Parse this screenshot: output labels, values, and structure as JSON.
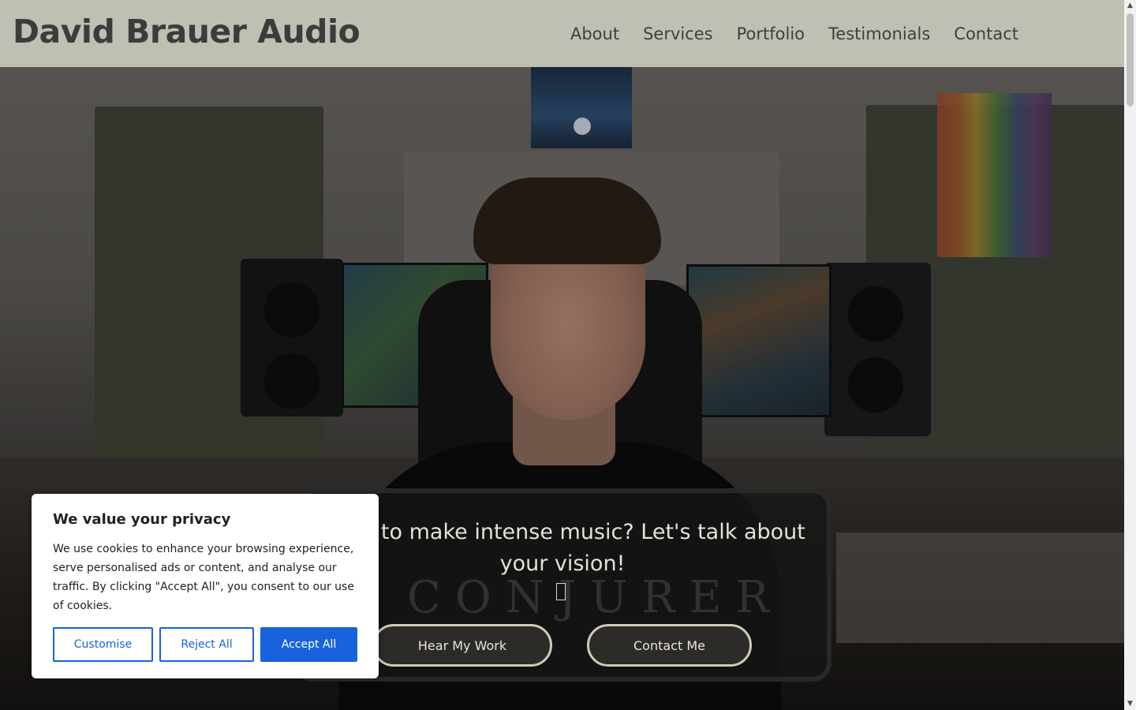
{
  "header": {
    "brand": "David Brauer Audio",
    "nav": [
      {
        "label": "About"
      },
      {
        "label": "Services"
      },
      {
        "label": "Portfolio"
      },
      {
        "label": "Testimonials"
      },
      {
        "label": "Contact"
      }
    ]
  },
  "hero": {
    "watermark": "CONJURER",
    "cta_heading": "Want to make intense music? Let's talk about your vision!",
    "cta_icon": "music-note-icon",
    "buttons": {
      "hear_work": "Hear My Work",
      "contact": "Contact Me"
    }
  },
  "cookie_banner": {
    "title": "We value your privacy",
    "text": "We use cookies to enhance your browsing experience, serve personalised ads or content, and analyse our traffic. By clicking \"Accept All\", you consent to our use of cookies.",
    "customise": "Customise",
    "reject": "Reject All",
    "accept": "Accept All",
    "accent_color": "#1863dc"
  },
  "colors": {
    "header_bg": "#c7c8ba",
    "button_border": "#cfcbb8"
  }
}
